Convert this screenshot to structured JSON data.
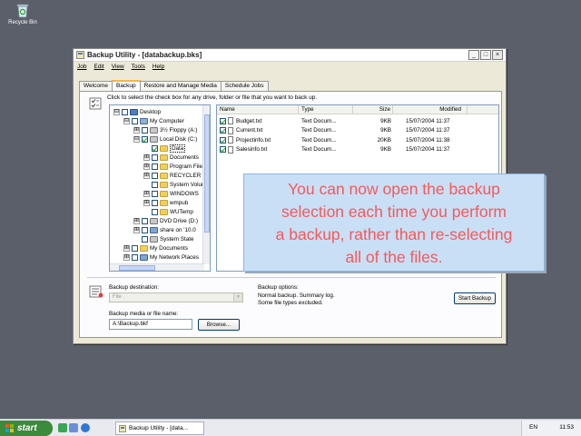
{
  "desktop": {
    "recycle_bin_label": "Recycle Bin"
  },
  "window": {
    "title": "Backup Utility - [databackup.bks]",
    "controls": {
      "minimize": "_",
      "maximize": "□",
      "close": "×"
    },
    "menu": [
      "Job",
      "Edit",
      "View",
      "Tools",
      "Help"
    ],
    "tabs": [
      "Welcome",
      "Backup",
      "Restore and Manage Media",
      "Schedule Jobs"
    ],
    "active_tab": "Backup"
  },
  "backup_tab": {
    "instruction": "Click to select the check box for any drive, folder or file that you want to back up.",
    "tree": [
      {
        "label": "Desktop",
        "depth": 0,
        "expander": "⊟",
        "checked": false,
        "icon": "desktop-icon"
      },
      {
        "label": "My Computer",
        "depth": 1,
        "expander": "⊟",
        "checked": false,
        "icon": "computer-icon"
      },
      {
        "label": "3½ Floppy (A:)",
        "depth": 2,
        "expander": "⊞",
        "checked": false,
        "icon": "drive-icon"
      },
      {
        "label": "Local Disk (C:)",
        "depth": 2,
        "expander": "⊟",
        "checked": true,
        "icon": "drive-icon"
      },
      {
        "label": "Data",
        "depth": 3,
        "expander": "",
        "checked": true,
        "icon": "folder-icon",
        "selected": true
      },
      {
        "label": "Documents",
        "depth": 3,
        "expander": "⊞",
        "checked": false,
        "icon": "folder-icon"
      },
      {
        "label": "Program Files",
        "depth": 3,
        "expander": "⊞",
        "checked": false,
        "icon": "folder-icon"
      },
      {
        "label": "RECYCLER",
        "depth": 3,
        "expander": "⊞",
        "checked": false,
        "icon": "folder-icon"
      },
      {
        "label": "System Volume",
        "depth": 3,
        "expander": "",
        "checked": false,
        "icon": "folder-icon"
      },
      {
        "label": "WINDOWS",
        "depth": 3,
        "expander": "⊞",
        "checked": false,
        "icon": "folder-icon"
      },
      {
        "label": "wmpub",
        "depth": 3,
        "expander": "⊞",
        "checked": false,
        "icon": "folder-icon"
      },
      {
        "label": "WUTemp",
        "depth": 3,
        "expander": "",
        "checked": false,
        "icon": "folder-icon"
      },
      {
        "label": "DVD Drive (D:)",
        "depth": 2,
        "expander": "⊞",
        "checked": false,
        "icon": "drive-icon"
      },
      {
        "label": "share on '10.0",
        "depth": 2,
        "expander": "⊞",
        "checked": false,
        "icon": "network-drive-icon"
      },
      {
        "label": "System State",
        "depth": 2,
        "expander": "",
        "checked": false,
        "icon": "drive-icon"
      },
      {
        "label": "My Documents",
        "depth": 1,
        "expander": "⊞",
        "checked": false,
        "icon": "folder-icon"
      },
      {
        "label": "My Network Places",
        "depth": 1,
        "expander": "⊞",
        "checked": false,
        "icon": "network-icon"
      }
    ],
    "file_columns": [
      "Name",
      "Type",
      "Size",
      "Modified"
    ],
    "files": [
      {
        "name": "Budget.txt",
        "type": "Text Docum...",
        "size": "9KB",
        "modified": "15/07/2004 11:37"
      },
      {
        "name": "Current.txt",
        "type": "Text Docum...",
        "size": "9KB",
        "modified": "15/07/2004 11:37"
      },
      {
        "name": "Projectinfo.txt",
        "type": "Text Docum...",
        "size": "20KB",
        "modified": "15/07/2004 11:38"
      },
      {
        "name": "Salesinfo.txt",
        "type": "Text Docum...",
        "size": "9KB",
        "modified": "15/07/2004 11:37"
      }
    ],
    "destination_label": "Backup destination:",
    "destination_value": "File",
    "media_label": "Backup media or file name:",
    "media_value": "A:\\Backup.bkf",
    "browse_label": "Browse...",
    "options_label": "Backup options:",
    "options_line1": "Normal backup.  Summary log.",
    "options_line2": "Some file types excluded.",
    "start_label": "Start Backup"
  },
  "callout": {
    "lines": [
      "You can now open the backup",
      "selection each time you  perform",
      "a backup, rather than re-selecting",
      "all of the files."
    ],
    "color": "#f35a5a"
  },
  "taskbar": {
    "start_label": "start",
    "task_label": "Backup Utility - [data...",
    "language": "EN",
    "clock": "11:53"
  }
}
